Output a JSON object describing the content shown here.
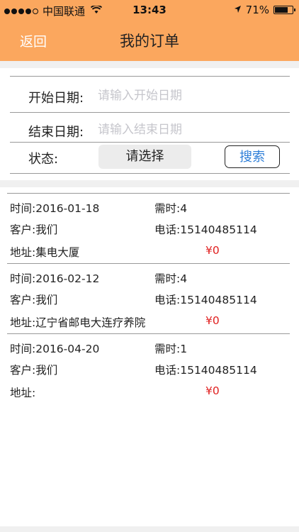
{
  "status_bar": {
    "carrier": "中国联通",
    "time": "13:43",
    "battery": "71%",
    "signal_bars_filled": 4,
    "signal_bars_total": 5
  },
  "nav": {
    "back_label": "返回",
    "title": "我的订单"
  },
  "filter": {
    "start_label": "开始日期:",
    "start_placeholder": "请输入开始日期",
    "end_label": "结束日期:",
    "end_placeholder": "请输入结束日期",
    "status_label": "状态:",
    "select_label": "请选择",
    "search_label": "搜索"
  },
  "orders": [
    {
      "time": "时间:2016-01-18",
      "duration": "需时:4",
      "customer": "客户:我们",
      "phone": "电话:15140485114",
      "address": "地址:集电大厦",
      "price": "¥0"
    },
    {
      "time": "时间:2016-02-12",
      "duration": "需时:4",
      "customer": "客户:我们",
      "phone": "电话:15140485114",
      "address": "地址:辽宁省邮电大连疗养院",
      "price": "¥0"
    },
    {
      "time": "时间:2016-04-20",
      "duration": "需时:1",
      "customer": "客户:我们",
      "phone": "电话:15140485114",
      "address": "地址:",
      "price": "¥0"
    }
  ],
  "colors": {
    "accent": "#fba75e",
    "price": "#e02020",
    "search_text": "#2f7fd8"
  }
}
